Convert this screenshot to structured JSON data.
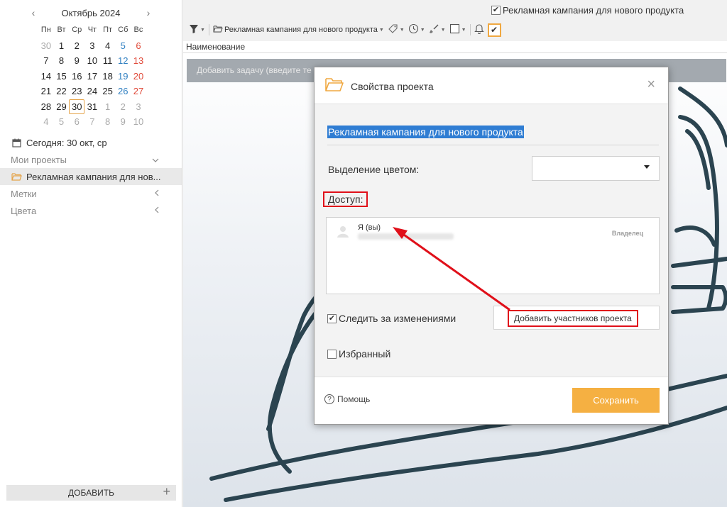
{
  "calendar": {
    "title": "Октябрь 2024",
    "prev": "‹",
    "next": "›",
    "dow": [
      "Пн",
      "Вт",
      "Ср",
      "Чт",
      "Пт",
      "Сб",
      "Вс"
    ],
    "weeks": [
      [
        "30",
        "1",
        "2",
        "3",
        "4",
        "5",
        "6"
      ],
      [
        "7",
        "8",
        "9",
        "10",
        "11",
        "12",
        "13"
      ],
      [
        "14",
        "15",
        "16",
        "17",
        "18",
        "19",
        "20"
      ],
      [
        "21",
        "22",
        "23",
        "24",
        "25",
        "26",
        "27"
      ],
      [
        "28",
        "29",
        "30",
        "31",
        "1",
        "2",
        "3"
      ],
      [
        "4",
        "5",
        "6",
        "7",
        "8",
        "9",
        "10"
      ]
    ]
  },
  "sidebar": {
    "today": "Сегодня: 30 окт, ср",
    "my_projects": "Мои проекты",
    "project": "Рекламная кампания для нов...",
    "tags": "Метки",
    "colors": "Цвета",
    "add_button": "ДОБАВИТЬ",
    "add_plus": "+"
  },
  "topbar": {
    "check_label": "Рекламная кампания для нового продукта",
    "project_filter": "Рекламная кампания для нового продукта"
  },
  "list": {
    "column_header": "Наименование",
    "task_placeholder": "Добавить задачу (введите те"
  },
  "dialog": {
    "title": "Свойства проекта",
    "close": "×",
    "project_name": "Рекламная кампания для нового продукта",
    "color_label": "Выделение цветом:",
    "access_label": "Доступ:",
    "member_name": "Я (вы)",
    "member_role": "Владелец",
    "track_changes": "Следить за изменениями",
    "add_members": "Добавить участников проекта",
    "favorite": "Избранный",
    "help": "Помощь",
    "save": "Сохранить"
  },
  "colors": {
    "accent": "#f5b042",
    "highlight": "#2f7dd3",
    "annotation_red": "#e0101a",
    "saturday": "#2f7fc1",
    "sunday": "#e04a3a"
  }
}
